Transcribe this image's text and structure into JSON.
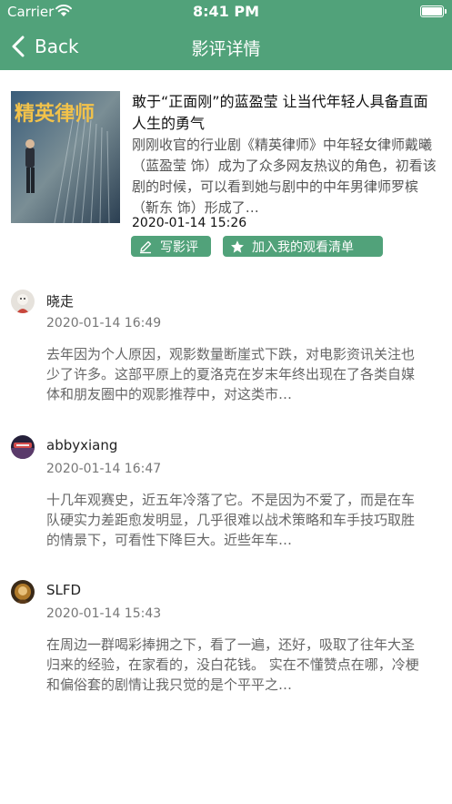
{
  "status_bar": {
    "carrier": "Carrier",
    "time": "8:41 PM"
  },
  "nav": {
    "back_label": "Back",
    "title": "影评详情"
  },
  "movie": {
    "poster_text": "精英律师",
    "title": "敢于“正面刚”的蓝盈莹 让当代年轻人具备直面人生的勇气",
    "summary": "刚刚收官的行业剧《精英律师》中年轻女律师戴曦（蓝盈莹 饰）成为了众多网友热议的角色，初看该剧的时候，可以看到她与剧中的中年男律师罗槟（靳东 饰）形成了…",
    "date": "2020-01-14 15:26",
    "write_review_label": "写影评",
    "add_watchlist_label": "加入我的观看清单"
  },
  "comments": [
    {
      "author": "晓走",
      "date": "2020-01-14 16:49",
      "text": "去年因为个人原因，观影数量断崖式下跌，对电影资讯关注也少了许多。这部平原上的夏洛克在岁末年终出现在了各类自媒体和朋友圈中的观影推荐中，对这类市…"
    },
    {
      "author": "abbyxiang",
      "date": "2020-01-14 16:47",
      "text": "十几年观赛史，近五年冷落了它。不是因为不爱了，而是在车队硬实力差距愈发明显，几乎很难以战术策略和车手技巧取胜的情景下，可看性下降巨大。近些年车…"
    },
    {
      "author": "SLFD",
      "date": "2020-01-14 15:43",
      "text": "在周边一群喝彩捧拥之下，看了一遍，还好，吸取了往年大圣归来的经验，在家看的，没白花钱。 实在不懂赞点在哪，冷梗和偏俗套的剧情让我只觉的是个平平之…"
    }
  ],
  "colors": {
    "accent": "#51a27a"
  }
}
